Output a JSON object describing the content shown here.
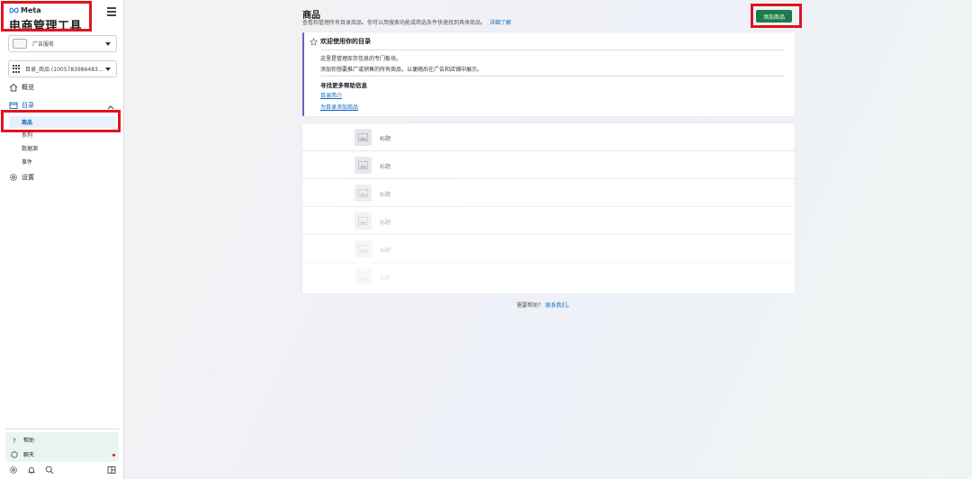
{
  "sidebar": {
    "brand": "Meta",
    "app_title": "电商管理工具",
    "account_select": "广告服务",
    "catalog_select": "目录_商品 (1005783986483…",
    "nav": {
      "overview": "概览",
      "catalog": "目录",
      "settings": "设置"
    },
    "subnav": {
      "products": "商品",
      "series": "系列",
      "data_sources": "数据源",
      "events": "事件"
    },
    "bottom": {
      "help": "帮助",
      "chat": "聊天"
    }
  },
  "main": {
    "title": "商品",
    "description": "查看和管理所有目录商品。你可以用搜索功能或筛选条件快速找到具体商品。",
    "learn_more": "详细了解",
    "add_button": "添加商品",
    "info_card": {
      "heading": "欢迎使用你的目录",
      "line1": "这里是管理库存信息的专门板块。",
      "line2": "添加你想要推广或销售的所有商品，以便随后在广告和店铺中展示。",
      "more_heading": "寻找更多帮助信息",
      "link1": "目录简介",
      "link2": "为目录添加商品"
    },
    "rows": [
      {
        "label": "标题"
      },
      {
        "label": "标题"
      },
      {
        "label": "标题"
      },
      {
        "label": "标题"
      },
      {
        "label": "标题"
      },
      {
        "label": "标题"
      }
    ],
    "help_prefix": "需要帮助？",
    "help_link": "联系我们。"
  },
  "colors": {
    "accent_blue": "#0a66c2",
    "add_button": "#1a7c4a",
    "annotation_red": "#e0141e",
    "info_border": "#6f5cc4"
  },
  "icons": [
    "hamburger-icon",
    "home-icon",
    "catalog-icon",
    "gear-icon",
    "star-icon",
    "image-placeholder-icon",
    "question-icon",
    "chat-icon",
    "bell-icon",
    "search-icon",
    "panel-icon"
  ]
}
